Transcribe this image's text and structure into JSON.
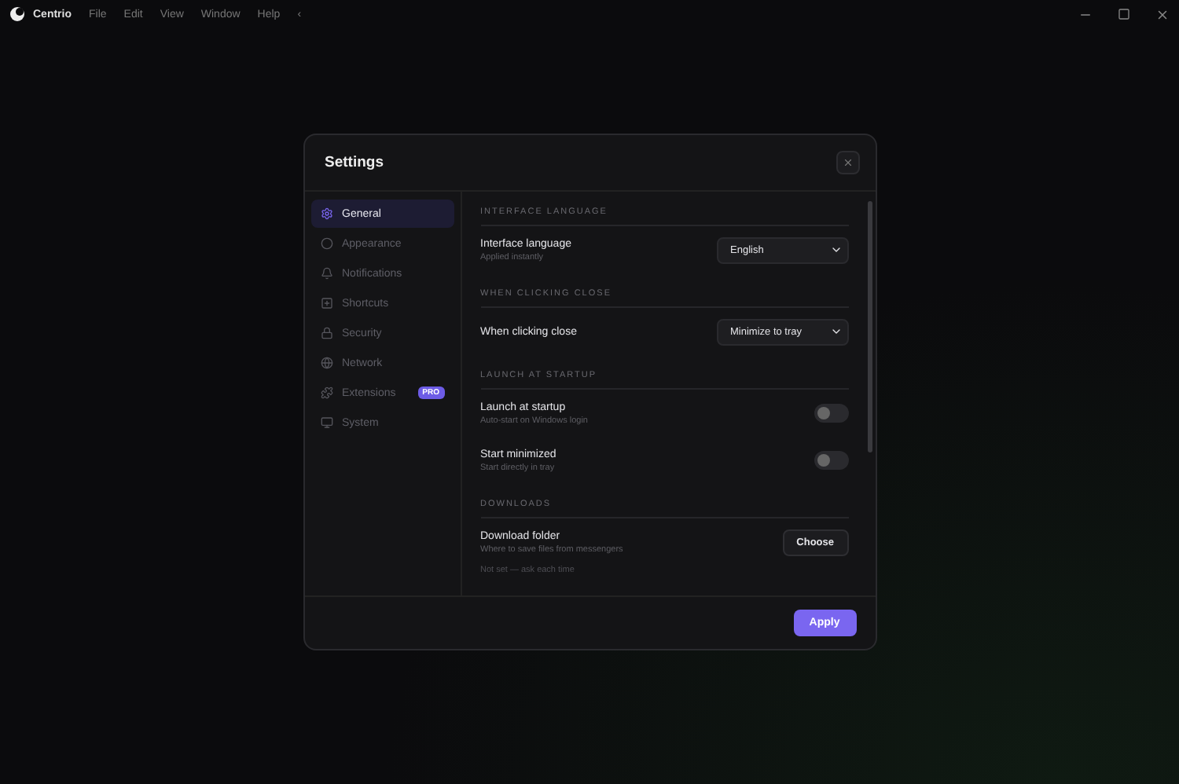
{
  "app": {
    "name": "Centrio",
    "menu": [
      "File",
      "Edit",
      "View",
      "Window",
      "Help"
    ],
    "back": "‹"
  },
  "dialog": {
    "title": "Settings",
    "sidebar": {
      "items": [
        {
          "label": "General",
          "selected": true
        },
        {
          "label": "Appearance",
          "selected": false
        },
        {
          "label": "Notifications",
          "selected": false
        },
        {
          "label": "Shortcuts",
          "selected": false
        },
        {
          "label": "Security",
          "selected": false
        },
        {
          "label": "Network",
          "selected": false
        },
        {
          "label": "Extensions",
          "selected": false,
          "badge": "PRO"
        },
        {
          "label": "System",
          "selected": false
        }
      ]
    },
    "sections": [
      {
        "heading": "INTERFACE LANGUAGE",
        "rows": [
          {
            "kind": "select",
            "label": "Interface language",
            "hint": "Applied instantly",
            "value": "English"
          }
        ]
      },
      {
        "heading": "WHEN CLICKING CLOSE",
        "rows": [
          {
            "kind": "select",
            "label": "When clicking close",
            "value": "Minimize to tray"
          }
        ]
      },
      {
        "heading": "LAUNCH AT STARTUP",
        "rows": [
          {
            "kind": "toggle",
            "label": "Launch at startup",
            "hint": "Auto-start on Windows login",
            "on": false
          },
          {
            "kind": "toggle",
            "label": "Start minimized",
            "hint": "Start directly in tray",
            "on": false
          }
        ]
      },
      {
        "heading": "DOWNLOADS",
        "rows": [
          {
            "kind": "button",
            "label": "Download folder",
            "hint": "Where to save files from messengers",
            "button": "Choose"
          },
          {
            "kind": "note",
            "label": "Not set — ask each time"
          }
        ]
      }
    ],
    "apply": "Apply"
  }
}
